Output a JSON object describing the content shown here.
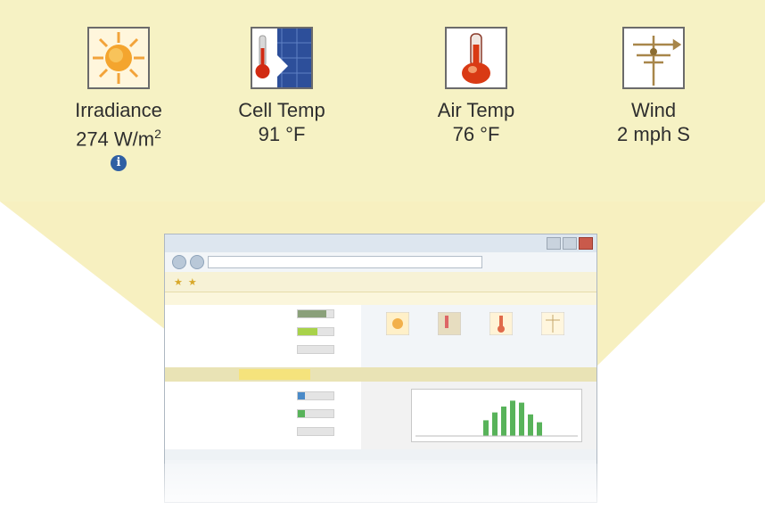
{
  "colors": {
    "panel": "#f6f2c4",
    "funnel": "#f7f0c0",
    "accent": "#58b35a",
    "info": "#2f5fa3"
  },
  "tiles": [
    {
      "icon": "sun-icon",
      "label": "Irradiance",
      "value": "274 W/m",
      "sup": "2",
      "info": "i"
    },
    {
      "icon": "cell-temp-icon",
      "label": "Cell Temp",
      "value": "91 °F"
    },
    {
      "icon": "thermometer-icon",
      "label": "Air Temp",
      "value": "76 °F"
    },
    {
      "icon": "weather-vane-icon",
      "label": "Wind",
      "value": "2 mph S"
    }
  ],
  "browser": {
    "icons": [
      "sun-icon",
      "cell-temp-icon",
      "thermometer-icon",
      "weather-vane-icon"
    ],
    "chart": {
      "type": "bar",
      "values": [
        0.4,
        0.6,
        0.75,
        0.9,
        0.85,
        0.55,
        0.35
      ]
    }
  }
}
